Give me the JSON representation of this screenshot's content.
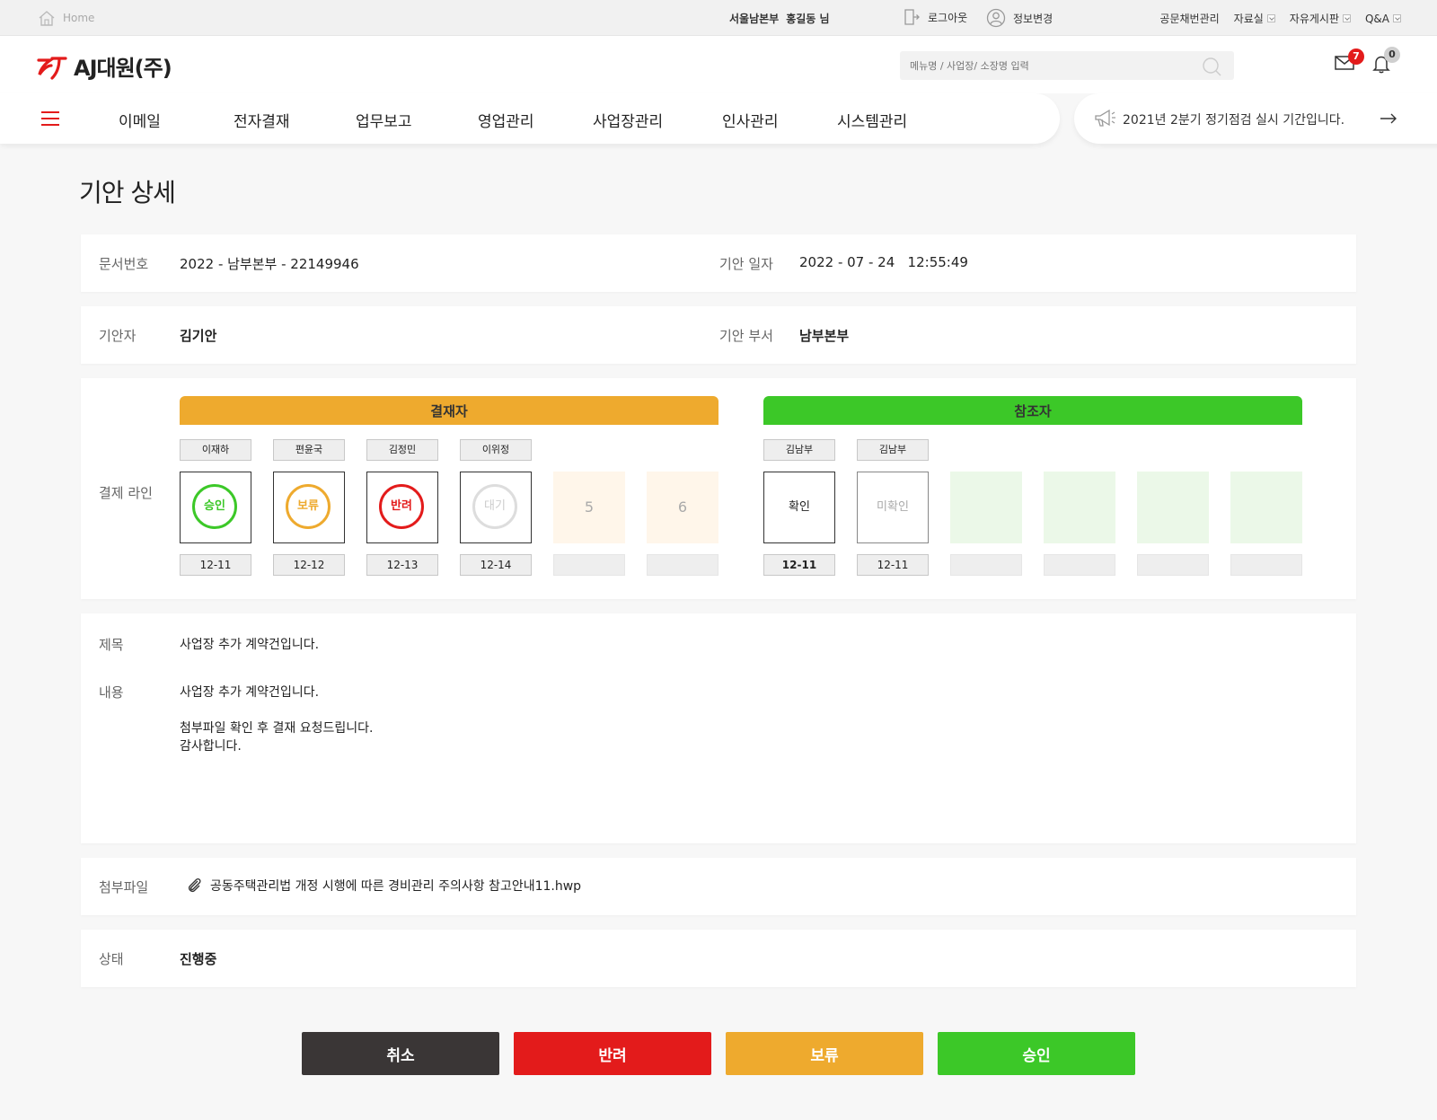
{
  "topbar": {
    "home": "Home",
    "branch": "서울남본부",
    "user": "홍길동 님",
    "logout": "로그아웃",
    "profile": "정보변경",
    "menu": [
      "공문채번관리",
      "자료실",
      "자유게시판",
      "Q&A"
    ]
  },
  "header": {
    "logo": "AJ대원(주)",
    "search_placeholder": "메뉴명 / 사업장/ 소장명 입력",
    "mail_count": "7",
    "bell_count": "0"
  },
  "nav": {
    "items": [
      "이메일",
      "전자결재",
      "업무보고",
      "영업관리",
      "사업장관리",
      "인사관리",
      "시스템관리"
    ],
    "notice": "2021년 2분기 정기점검 실시 기간입니다."
  },
  "page": {
    "title": "기안 상세",
    "doc_no_label": "문서번호",
    "doc_no": "2022 - 남부본부 - 22149946",
    "draft_date_label": "기안 일자",
    "draft_date": "2022 - 07 - 24   12:55:49",
    "drafter_label": "기안자",
    "drafter": "김기안",
    "dept_label": "기안 부서",
    "dept": "남부본부",
    "line_label": "결제 라인",
    "subject_label": "제목",
    "subject": "사업장 추가 계약건입니다.",
    "body_label": "내용",
    "body_line1": "사업장 추가 계약건입니다.",
    "body_line2": "첨부파일 확인 후 결재 요청드립니다.",
    "body_line3": "감사합니다.",
    "attach_label": "첨부파일",
    "attach_file": "공동주택관리법 개정 시행에 따른 경비관리 주의사항 참고안내11.hwp",
    "status_label": "상태",
    "status": "진행중"
  },
  "approvers": {
    "title": "결재자",
    "items": [
      {
        "name": "이재하",
        "stamp": "승인",
        "date": "12-11"
      },
      {
        "name": "편윤국",
        "stamp": "보류",
        "date": "12-12"
      },
      {
        "name": "김정민",
        "stamp": "반려",
        "date": "12-13"
      },
      {
        "name": "이위정",
        "stamp": "대기",
        "date": "12-14"
      }
    ],
    "empty": [
      "5",
      "6"
    ]
  },
  "referrers": {
    "title": "참조자",
    "items": [
      {
        "name": "김남부",
        "status": "확인",
        "date": "12-11"
      },
      {
        "name": "김남부",
        "status": "미확인",
        "date": "12-11"
      }
    ]
  },
  "buttons": {
    "cancel": "취소",
    "reject": "반려",
    "hold": "보류",
    "approve": "승인"
  },
  "colors": {
    "red": "#e31b1b",
    "orange": "#eeaa2e",
    "green": "#3cc828",
    "dark": "#3a3636"
  }
}
